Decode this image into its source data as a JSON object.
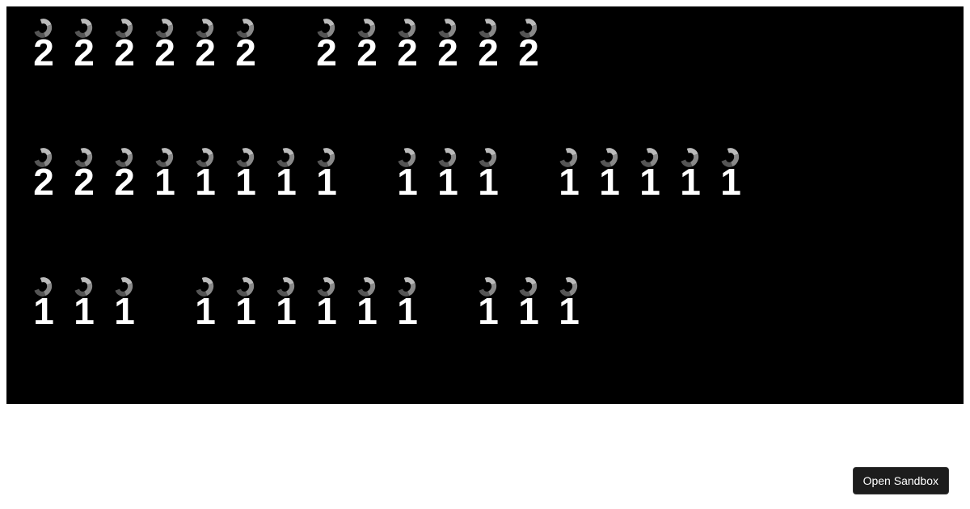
{
  "rows": [
    {
      "pattern": [
        "2",
        "2",
        "2",
        "2",
        "2",
        "2",
        " ",
        "2",
        "2",
        "2",
        "2",
        "2",
        "2"
      ]
    },
    {
      "pattern": [
        "2",
        "2",
        "2",
        "1",
        "1",
        "1",
        "1",
        "1",
        " ",
        "1",
        "1",
        "1",
        " ",
        "1",
        "1",
        "1",
        "1",
        "1"
      ]
    },
    {
      "pattern": [
        "1",
        "1",
        "1",
        " ",
        "1",
        "1",
        "1",
        "1",
        "1",
        "1",
        " ",
        "1",
        "1",
        "1"
      ]
    }
  ],
  "button": {
    "label": "Open Sandbox"
  }
}
